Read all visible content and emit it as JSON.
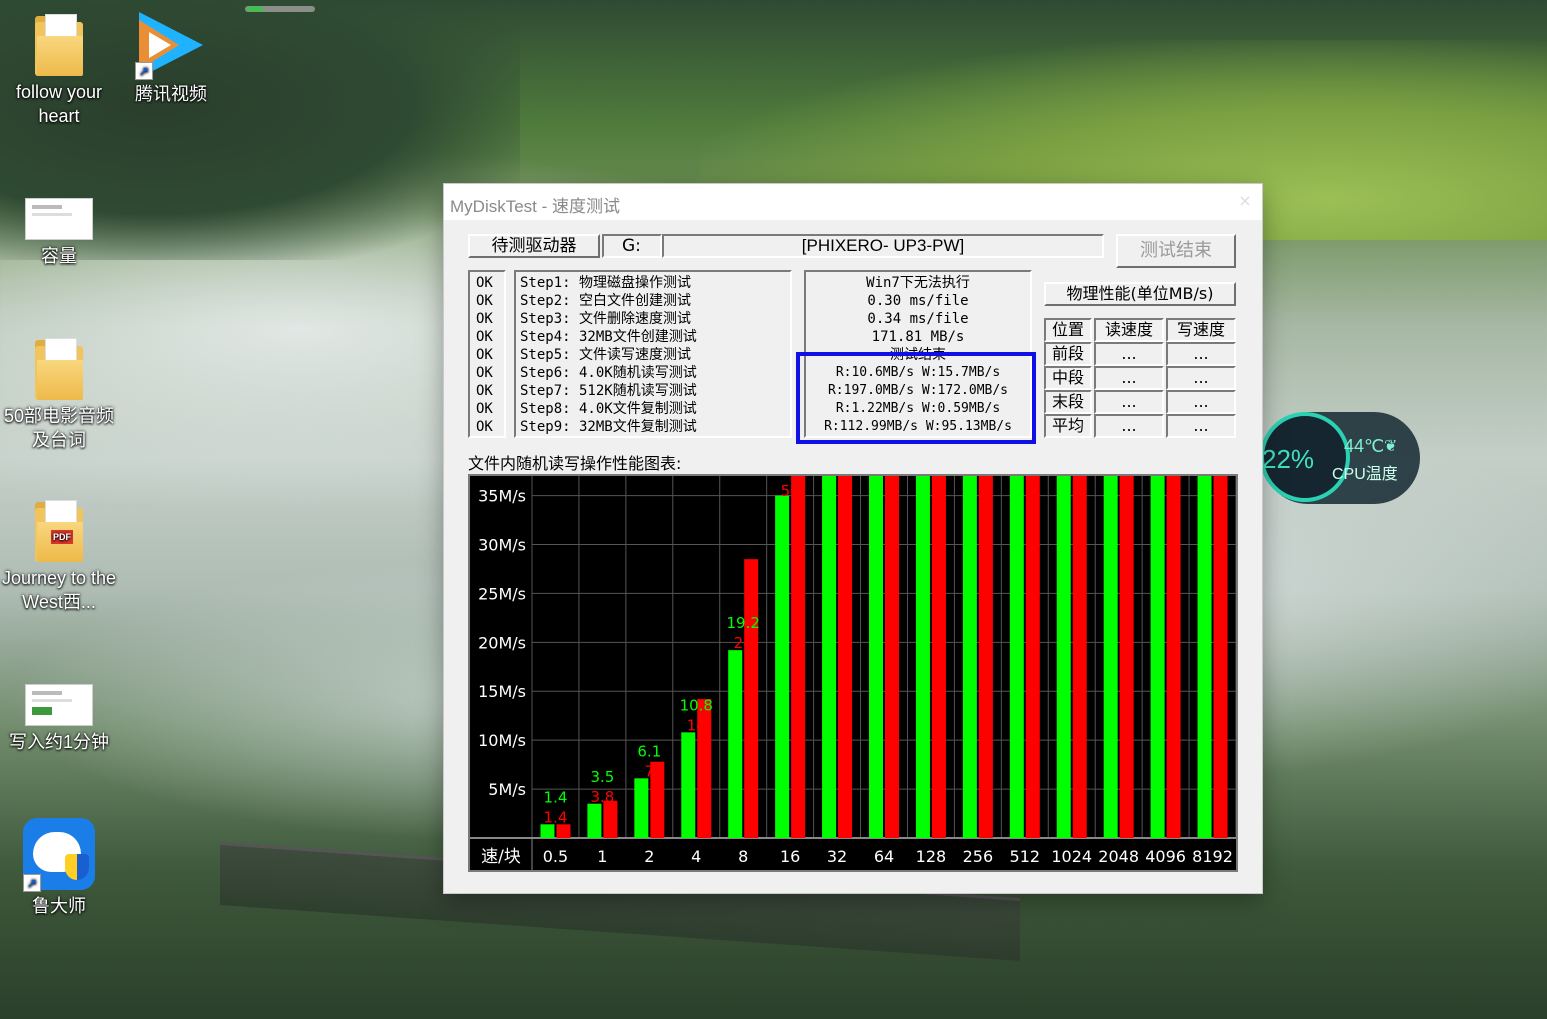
{
  "desktop": {
    "icons": [
      {
        "label": "follow your heart",
        "icon": "folder-photos-icon"
      },
      {
        "label": "腾讯视频",
        "icon": "tencent-video-icon"
      },
      {
        "label": "容量",
        "icon": "screenshot-thumbnail-icon"
      },
      {
        "label": "50部电影音频及台词",
        "icon": "folder-icon"
      },
      {
        "label": "Journey to the West西...",
        "icon": "folder-pdf-icon"
      },
      {
        "label": "写入约1分钟",
        "icon": "screenshot-thumbnail-icon"
      },
      {
        "label": "鲁大师",
        "icon": "ludashi-icon"
      }
    ]
  },
  "cpu_widget": {
    "usage": "22%",
    "temp": "44℃",
    "label": "CPU温度"
  },
  "window": {
    "title": "MyDiskTest - 速度测试",
    "close": "×",
    "drive_label": "待测驱动器",
    "drive_letter": "G:",
    "drive_name": "[PHIXERO- UP3-PW]",
    "end_button": "测试结束",
    "status": [
      "OK",
      "OK",
      "OK",
      "OK",
      "OK",
      "OK",
      "OK",
      "OK",
      "OK"
    ],
    "steps": [
      "Step1: 物理磁盘操作测试",
      "Step2: 空白文件创建测试",
      "Step3: 文件删除速度测试",
      "Step4: 32MB文件创建测试",
      "Step5: 文件读写速度测试",
      "Step6: 4.0K随机读写测试",
      "Step7: 512K随机读写测试",
      "Step8: 4.0K文件复制测试",
      "Step9: 32MB文件复制测试"
    ],
    "results": [
      "Win7下无法执行",
      "0.30 ms/file",
      "0.34 ms/file",
      "171.81 MB/s",
      "测试结束",
      "R:10.6MB/s W:15.7MB/s",
      "R:197.0MB/s W:172.0MB/s",
      "R:1.22MB/s W:0.59MB/s",
      "R:112.99MB/s W:95.13MB/s"
    ],
    "perf_title": "物理性能(单位MB/s)",
    "perf_headers": [
      "位置",
      "读速度",
      "写速度"
    ],
    "perf_rows": [
      {
        "pos": "前段",
        "read": "...",
        "write": "..."
      },
      {
        "pos": "中段",
        "read": "...",
        "write": "..."
      },
      {
        "pos": "末段",
        "read": "...",
        "write": "..."
      },
      {
        "pos": "平均",
        "read": "...",
        "write": "..."
      }
    ],
    "chart_title": "文件内随机读写操作性能图表:"
  },
  "chart_data": {
    "type": "bar",
    "title": "文件内随机读写操作性能图表:",
    "xlabel": "速/块",
    "ylabel": "",
    "categories": [
      "0.5",
      "1",
      "2",
      "4",
      "8",
      "16",
      "32",
      "64",
      "128",
      "256",
      "512",
      "1024",
      "2048",
      "4096",
      "8192"
    ],
    "series": [
      {
        "color": "#00ff00",
        "values": [
          1.4,
          3.5,
          6.1,
          10.8,
          19.2,
          35,
          40,
          40,
          40,
          40,
          40,
          40,
          40,
          40,
          40
        ]
      },
      {
        "color": "#ff0000",
        "values": [
          1.4,
          3.8,
          7.8,
          14.2,
          28.5,
          50,
          40,
          40,
          40,
          40,
          40,
          40,
          40,
          40,
          40
        ]
      }
    ],
    "value_labels_green": [
      "1.4",
      "3.5",
      "6.1",
      "10.8",
      "19.2",
      "",
      "",
      "",
      "",
      "",
      "",
      "",
      "",
      "",
      ""
    ],
    "value_labels_red": [
      "1.4",
      "3.8",
      "7",
      "14",
      "28",
      "50",
      "",
      "",
      "",
      "",
      "",
      "",
      "",
      "",
      ""
    ],
    "y_ticks": [
      "5M/s",
      "10M/s",
      "15M/s",
      "20M/s",
      "25M/s",
      "30M/s",
      "35M/s"
    ],
    "ylim": [
      0,
      37
    ],
    "grid": true,
    "colors": {
      "background": "#000000",
      "read": "#00ff00",
      "write": "#ff0000",
      "grid": "#555555"
    }
  }
}
